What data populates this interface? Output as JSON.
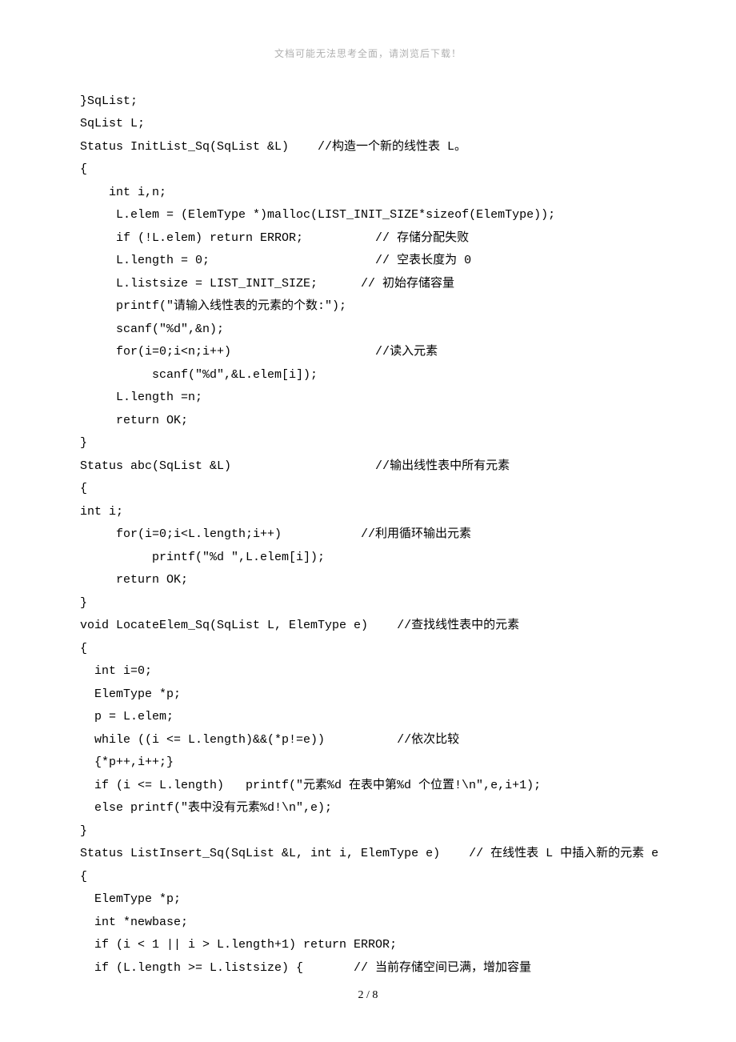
{
  "header": {
    "note": "文档可能无法思考全面，请浏览后下载！"
  },
  "code": {
    "lines": [
      "}SqList;",
      "SqList L;",
      "Status InitList_Sq(SqList &L)    //构造一个新的线性表 L。",
      "{",
      "    int i,n;",
      "     L.elem = (ElemType *)malloc(LIST_INIT_SIZE*sizeof(ElemType));",
      "     if (!L.elem) return ERROR;          // 存储分配失败",
      "     L.length = 0;                       // 空表长度为 0",
      "     L.listsize = LIST_INIT_SIZE;      // 初始存储容量",
      "     printf(\"请输入线性表的元素的个数:\");",
      "     scanf(\"%d\",&n);",
      "     for(i=0;i<n;i++)                    //读入元素",
      "          scanf(\"%d\",&L.elem[i]);",
      "     L.length =n;",
      "     return OK;",
      "}",
      "Status abc(SqList &L)                    //输出线性表中所有元素",
      "{",
      "int i;",
      "     for(i=0;i<L.length;i++)           //利用循环输出元素",
      "          printf(\"%d \",L.elem[i]);",
      "     return OK;",
      "}",
      "void LocateElem_Sq(SqList L, ElemType e)    //查找线性表中的元素",
      "{",
      "  int i=0;",
      "  ElemType *p;",
      "  p = L.elem;",
      "  while ((i <= L.length)&&(*p!=e))          //依次比较",
      "  {*p++,i++;}",
      "  if (i <= L.length)   printf(\"元素%d 在表中第%d 个位置!\\n\",e,i+1);",
      "  else printf(\"表中没有元素%d!\\n\",e);",
      "}",
      "Status ListInsert_Sq(SqList &L, int i, ElemType e)    // 在线性表 L 中插入新的元素 e",
      "{",
      "  ElemType *p;",
      "  int *newbase;",
      "  if (i < 1 || i > L.length+1) return ERROR;",
      "  if (L.length >= L.listsize) {       // 当前存储空间已满，增加容量"
    ]
  },
  "footer": {
    "page": "2 / 8"
  }
}
